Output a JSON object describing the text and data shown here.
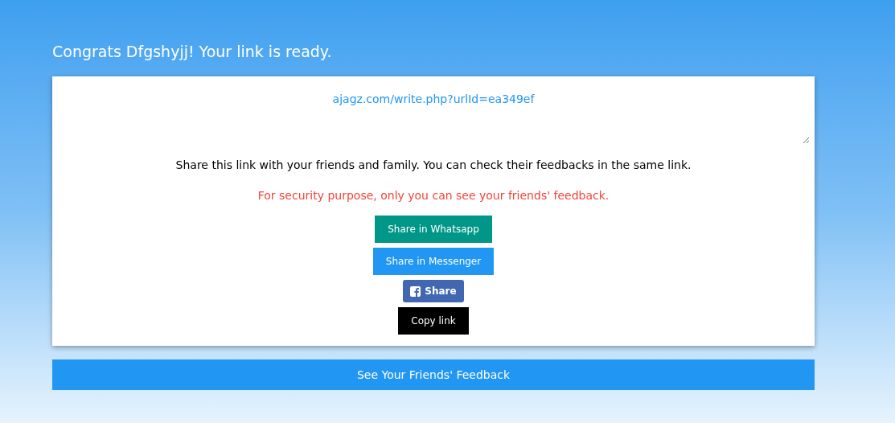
{
  "title": "Congrats Dfgshyjj! Your link is ready.",
  "link_field": {
    "value": "ajagz.com/write.php?urlId=ea349ef"
  },
  "description": "Share this link with your friends and family. You can check their feedbacks in the same link.",
  "security_note": "For security purpose, only you can see your friends' feedback.",
  "share_buttons": [
    {
      "kind": "whatsapp",
      "label": "Share in Whatsapp"
    },
    {
      "kind": "messenger",
      "label": "Share in Messenger"
    },
    {
      "kind": "facebook",
      "label": "Share"
    },
    {
      "kind": "copy",
      "label": "Copy link"
    }
  ],
  "feedback_button": {
    "label": "See Your Friends' Feedback"
  }
}
